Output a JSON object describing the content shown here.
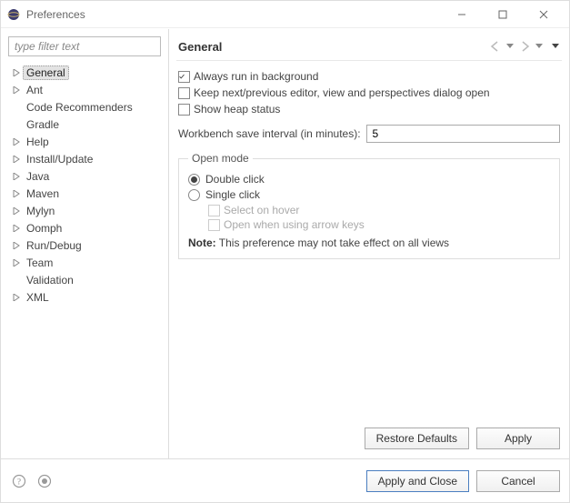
{
  "window": {
    "title": "Preferences"
  },
  "filter": {
    "placeholder": "type filter text"
  },
  "tree": {
    "items": [
      {
        "label": "General",
        "expandable": true,
        "selected": true
      },
      {
        "label": "Ant",
        "expandable": true,
        "selected": false
      },
      {
        "label": "Code Recommenders",
        "expandable": false,
        "selected": false
      },
      {
        "label": "Gradle",
        "expandable": false,
        "selected": false
      },
      {
        "label": "Help",
        "expandable": true,
        "selected": false
      },
      {
        "label": "Install/Update",
        "expandable": true,
        "selected": false
      },
      {
        "label": "Java",
        "expandable": true,
        "selected": false
      },
      {
        "label": "Maven",
        "expandable": true,
        "selected": false
      },
      {
        "label": "Mylyn",
        "expandable": true,
        "selected": false
      },
      {
        "label": "Oomph",
        "expandable": true,
        "selected": false
      },
      {
        "label": "Run/Debug",
        "expandable": true,
        "selected": false
      },
      {
        "label": "Team",
        "expandable": true,
        "selected": false
      },
      {
        "label": "Validation",
        "expandable": false,
        "selected": false
      },
      {
        "label": "XML",
        "expandable": true,
        "selected": false
      }
    ]
  },
  "page": {
    "title": "General",
    "checkboxes": {
      "always_run_bg": {
        "label": "Always run in background",
        "checked": true
      },
      "keep_editor_dialog": {
        "label": "Keep next/previous editor, view and perspectives dialog open",
        "checked": false
      },
      "show_heap": {
        "label": "Show heap status",
        "checked": false
      }
    },
    "save_interval": {
      "label": "Workbench save interval (in minutes):",
      "value": "5"
    },
    "open_mode": {
      "legend": "Open mode",
      "double_click": {
        "label": "Double click",
        "checked": true
      },
      "single_click": {
        "label": "Single click",
        "checked": false
      },
      "select_on_hover": {
        "label": "Select on hover",
        "disabled": true,
        "checked": false
      },
      "open_on_arrow": {
        "label": "Open when using arrow keys",
        "disabled": true,
        "checked": false
      },
      "note_label": "Note:",
      "note_text": "This preference may not take effect on all views"
    },
    "buttons": {
      "restore_defaults": "Restore Defaults",
      "apply": "Apply"
    }
  },
  "footer": {
    "apply_close": "Apply and Close",
    "cancel": "Cancel"
  }
}
